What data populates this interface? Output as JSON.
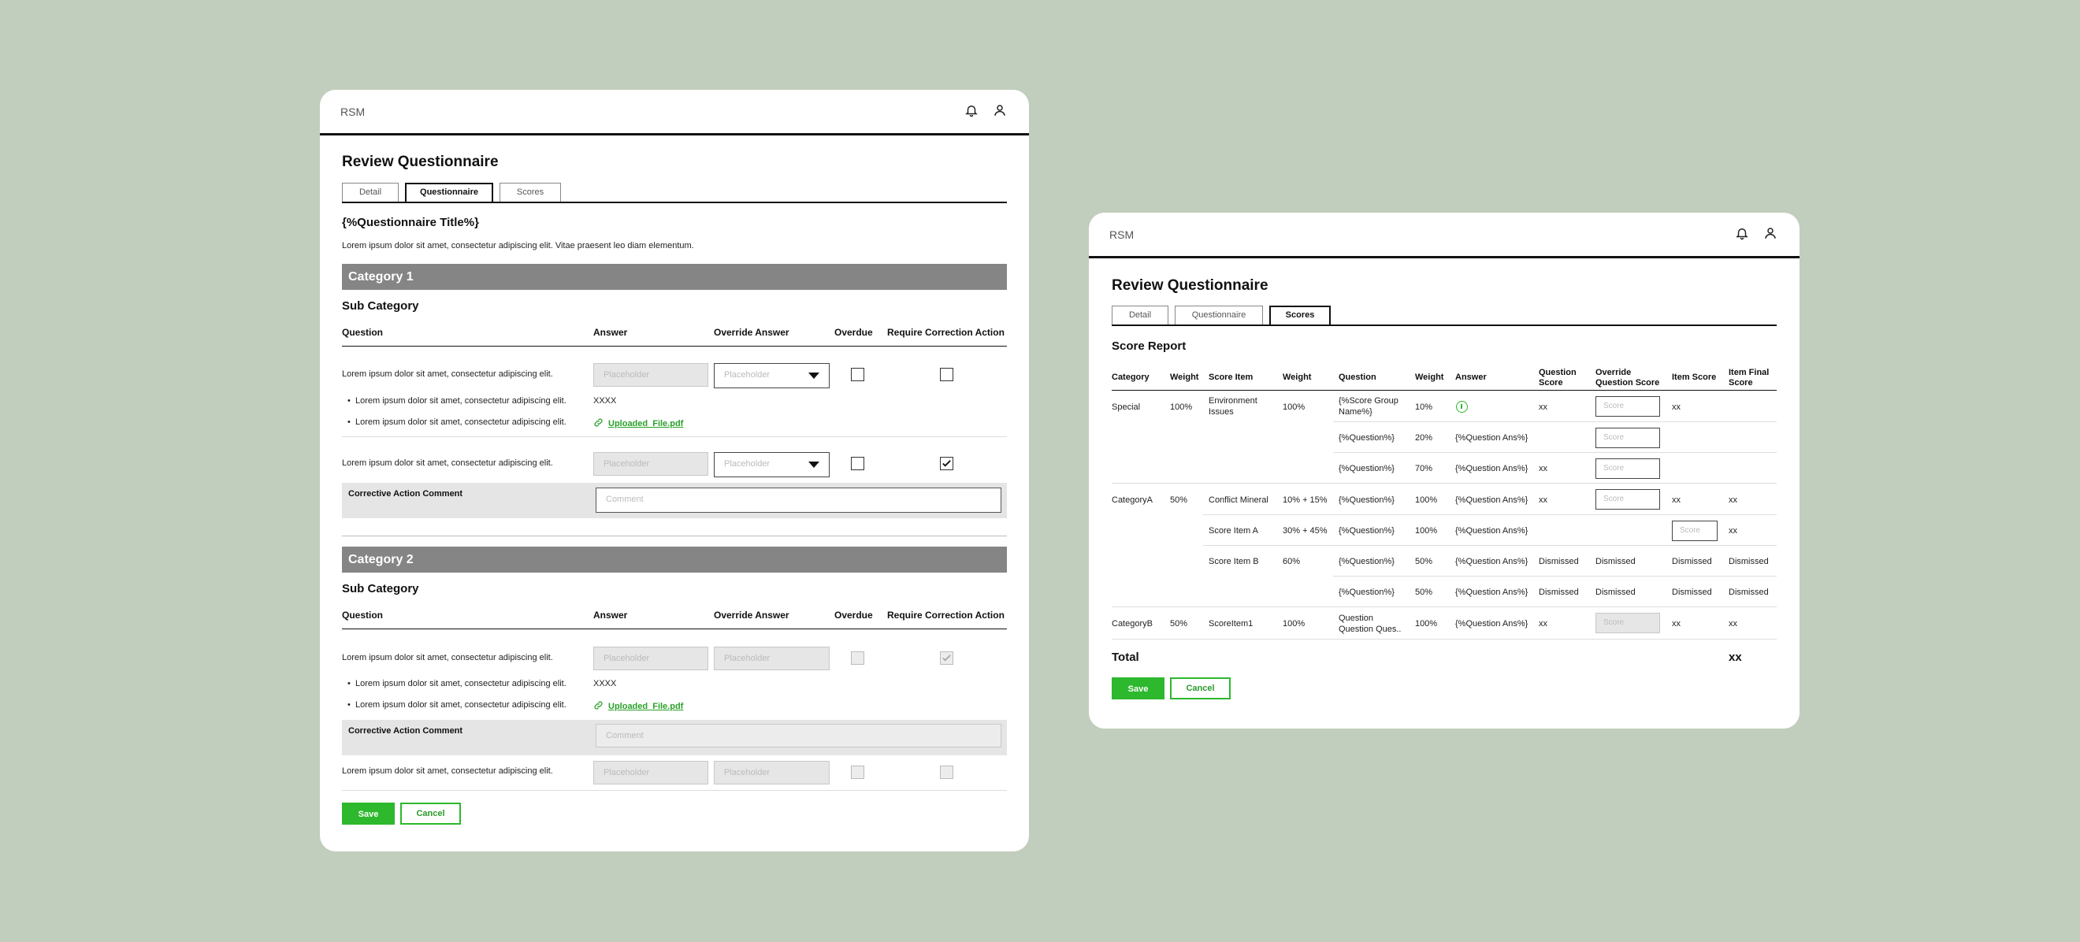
{
  "left": {
    "logo": "RSM",
    "title": "Review Questionnaire",
    "tabs": [
      "Detail",
      "Questionnaire",
      "Scores"
    ],
    "questionnaire_title": "{%Questionnaire Title%}",
    "description": "Lorem ipsum dolor sit amet, consectetur adipiscing elit. Vitae praesent leo diam elementum.",
    "columns": [
      "Question",
      "Answer",
      "Override Answer",
      "Overdue",
      "Require Correction Action"
    ],
    "category1": {
      "name": "Category 1",
      "subcategory": "Sub Category",
      "q1": "Lorem ipsum dolor sit amet, consectetur adipiscing elit.",
      "q1_answer_placeholder": "Placeholder",
      "q1_override_placeholder": "Placeholder",
      "q1_sub1": "Lorem ipsum dolor sit amet, consectetur adipiscing elit.",
      "q1_sub1_value": "XXXX",
      "q1_sub2": "Lorem ipsum dolor sit amet, consectetur adipiscing elit.",
      "q1_sub2_file": "Uploaded_File.pdf",
      "q2": "Lorem ipsum dolor sit amet, consectetur adipiscing elit.",
      "q2_answer_placeholder": "Placeholder",
      "q2_override_placeholder": "Placeholder",
      "corrective_label": "Corrective Action Comment",
      "comment_placeholder": "Comment"
    },
    "category2": {
      "name": "Category 2",
      "subcategory": "Sub Category",
      "q1": "Lorem ipsum dolor sit amet, consectetur adipiscing elit.",
      "q1_answer_placeholder": "Placeholder",
      "q1_override_placeholder": "Placeholder",
      "q1_sub1": "Lorem ipsum dolor sit amet, consectetur adipiscing elit.",
      "q1_sub1_value": "XXXX",
      "q1_sub2": "Lorem ipsum dolor sit amet, consectetur adipiscing elit.",
      "q1_sub2_file": "Uploaded_File.pdf",
      "corrective_label": "Corrective Action Comment",
      "comment_placeholder": "Comment",
      "q2": "Lorem ipsum dolor sit amet, consectetur adipiscing elit.",
      "q2_answer_placeholder": "Placeholder",
      "q2_override_placeholder": "Placeholder"
    },
    "save": "Save",
    "cancel": "Cancel"
  },
  "right": {
    "logo": "RSM",
    "title": "Review Questionnaire",
    "tabs": [
      "Detail",
      "Questionnaire",
      "Scores"
    ],
    "report_title": "Score Report",
    "columns": [
      "Category",
      "Weight",
      "Score Item",
      "Weight",
      "Question",
      "Weight",
      "Answer",
      "Question Score",
      "Override Question Score",
      "Item Score",
      "Item Final Score"
    ],
    "rows": {
      "special_cat": "Special",
      "special_w": "100%",
      "env_item": "Environment Issues",
      "env_w": "100%",
      "r1_q": "{%Score Group Name%}",
      "r1_w": "10%",
      "r1_qs": "xx",
      "r1_is": "xx",
      "r2_q": "{%Question%}",
      "r2_w": "20%",
      "r2_a": "{%Question Ans%}",
      "r3_q": "{%Question%}",
      "r3_w": "70%",
      "r3_a": "{%Question Ans%}",
      "r3_qs": "xx",
      "catA": "CategoryA",
      "catA_w": "50%",
      "conflict_item": "Conflict Mineral",
      "conflict_w": "10% + 15%",
      "r4_q": "{%Question%}",
      "r4_w": "100%",
      "r4_a": "{%Question Ans%}",
      "r4_qs": "xx",
      "r4_is": "xx",
      "r4_fs": "xx",
      "itemA": "Score Item A",
      "itemA_w": "30% + 45%",
      "r5_q": "{%Question%}",
      "r5_w": "100%",
      "r5_a": "{%Question Ans%}",
      "r5_fs": "xx",
      "itemB": "Score Item B",
      "itemB_w": "60%",
      "r6_q": "{%Question%}",
      "r6_w": "50%",
      "r6_a": "{%Question Ans%}",
      "r6_qs": "Dismissed",
      "r6_oqs": "Dismissed",
      "r6_is": "Dismissed",
      "r6_fs": "Dismissed",
      "r7_q": "{%Question%}",
      "r7_w": "50%",
      "r7_a": "{%Question Ans%}",
      "r7_qs": "Dismissed",
      "r7_oqs": "Dismissed",
      "r7_is": "Dismissed",
      "r7_fs": "Dismissed",
      "catB": "CategoryB",
      "catB_w": "50%",
      "score1": "ScoreItem1",
      "score1_w": "100%",
      "r8_q": "Question Question Ques..",
      "r8_w": "100%",
      "r8_a": "{%Question Ans%}",
      "r8_qs": "xx",
      "r8_is": "xx",
      "r8_fs": "xx"
    },
    "score_placeholder": "Score",
    "total_label": "Total",
    "total_value": "xx",
    "save": "Save",
    "cancel": "Cancel"
  },
  "colors": {
    "accent": "#2db82d",
    "category_bar": "#858585",
    "background": "#c2cebd"
  },
  "icons": [
    "bell-icon",
    "user-icon",
    "chevron-down-icon",
    "checkmark-icon",
    "link-icon",
    "info-icon"
  ]
}
